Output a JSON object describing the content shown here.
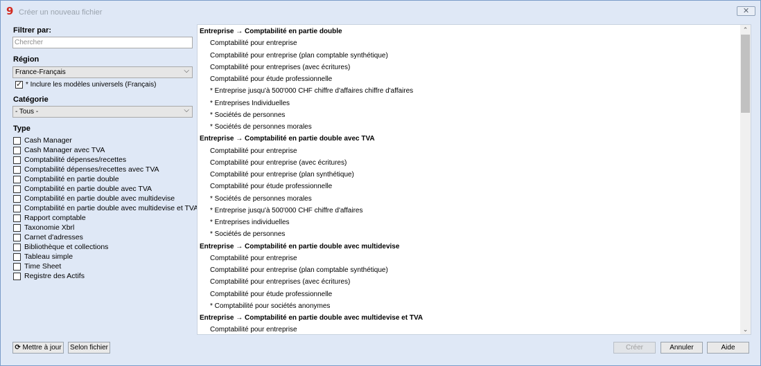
{
  "window": {
    "title": "Créer un nouveau fichier",
    "app_icon": "9",
    "close_label": "✕"
  },
  "filter": {
    "label": "Filtrer par:",
    "search_placeholder": "Chercher"
  },
  "region": {
    "label": "Région",
    "selected": "France-Français",
    "include_universal": {
      "label": "* Inclure les modèles universels (Français)",
      "checked": true
    }
  },
  "category": {
    "label": "Catégorie",
    "selected": "- Tous -"
  },
  "type": {
    "label": "Type",
    "items": [
      "Cash Manager",
      "Cash Manager avec TVA",
      "Comptabilité dépenses/recettes",
      "Comptabilité dépenses/recettes avec TVA",
      "Comptabilité en partie double",
      "Comptabilité en partie double avec TVA",
      "Comptabilité en partie double avec multidevise",
      "Comptabilité en partie double avec multidevise et TVA",
      "Rapport comptable",
      "Taxonomie Xbrl",
      "Carnet d'adresses",
      "Bibliothèque et collections",
      "Tableau simple",
      "Time Sheet",
      "Registre des Actifs"
    ]
  },
  "templates": [
    {
      "kind": "group",
      "text": "Entreprise → Comptabilité en partie double"
    },
    {
      "kind": "item",
      "text": "Comptabilité pour entreprise"
    },
    {
      "kind": "item",
      "text": "Comptabilité pour entreprise (plan comptable synthétique)"
    },
    {
      "kind": "item",
      "text": "Comptabilité pour entreprises (avec écritures)"
    },
    {
      "kind": "item",
      "text": "Comptabilité pour étude professionnelle"
    },
    {
      "kind": "item",
      "text": "* Entreprise jusqu'à 500'000 CHF chiffre d'affaires chiffre d'affaires"
    },
    {
      "kind": "item",
      "text": "* Entreprises Individuelles"
    },
    {
      "kind": "item",
      "text": "* Sociétés de personnes"
    },
    {
      "kind": "item",
      "text": "* Sociétés de personnes morales"
    },
    {
      "kind": "group",
      "text": "Entreprise → Comptabilité en partie double avec TVA"
    },
    {
      "kind": "item",
      "text": "Comptabilité pour entreprise"
    },
    {
      "kind": "item",
      "text": "Comptabilité pour entreprise (avec écritures)"
    },
    {
      "kind": "item",
      "text": "Comptabilité pour entreprise (plan synthétique)"
    },
    {
      "kind": "item",
      "text": "Comptabilité pour étude professionnelle"
    },
    {
      "kind": "item",
      "text": "*  Sociétés de personnes morales"
    },
    {
      "kind": "item",
      "text": "* Entreprise jusqu'à 500'000 CHF chiffre d'affaires"
    },
    {
      "kind": "item",
      "text": "* Entreprises individuelles"
    },
    {
      "kind": "item",
      "text": "* Sociétés de personnes"
    },
    {
      "kind": "group",
      "text": "Entreprise → Comptabilité en partie double avec multidevise"
    },
    {
      "kind": "item",
      "text": "Comptabilité pour entreprise"
    },
    {
      "kind": "item",
      "text": "Comptabilité pour entreprise (plan comptable synthétique)"
    },
    {
      "kind": "item",
      "text": "Comptabilité pour entreprises (avec écritures)"
    },
    {
      "kind": "item",
      "text": "Comptabilité pour étude professionnelle"
    },
    {
      "kind": "item",
      "text": "* Comptabilité pour sociétés anonymes"
    },
    {
      "kind": "group",
      "text": "Entreprise → Comptabilité en partie double avec multidevise et TVA"
    },
    {
      "kind": "item",
      "text": "Comptabilité pour entreprise"
    }
  ],
  "buttons": {
    "update": "Mettre à jour",
    "by_file": "Selon fichier",
    "create": "Créer",
    "cancel": "Annuler",
    "help": "Aide"
  }
}
